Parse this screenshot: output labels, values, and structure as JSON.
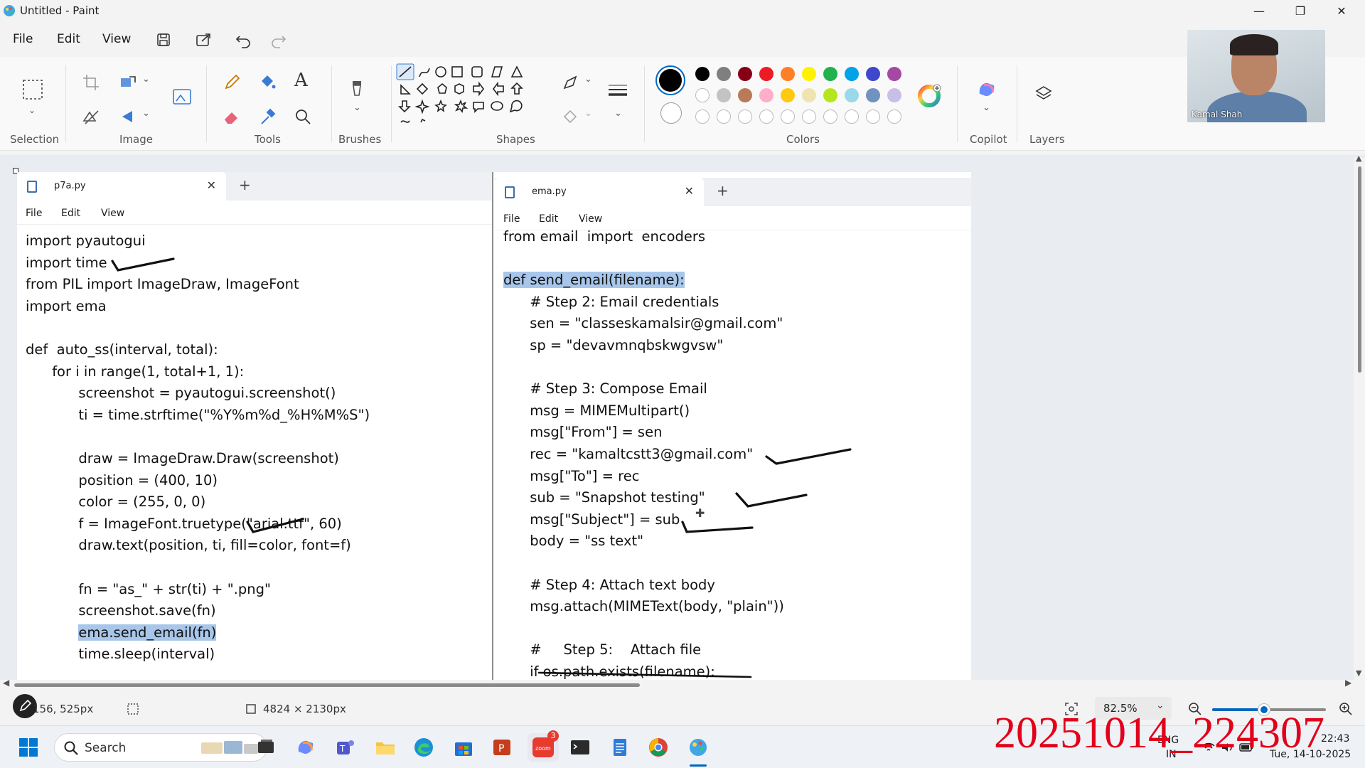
{
  "window": {
    "title": "Untitled - Paint"
  },
  "menu": {
    "file": "File",
    "edit": "Edit",
    "view": "View"
  },
  "ribbon": {
    "groups": {
      "selection": "Selection",
      "image": "Image",
      "tools": "Tools",
      "brushes": "Brushes",
      "shapes": "Shapes",
      "colors": "Colors",
      "copilot": "Copilot",
      "layers": "Layers"
    },
    "palette_row1": [
      "#000000",
      "#7f7f7f",
      "#880015",
      "#ed1c24",
      "#ff7f27",
      "#fff200",
      "#22b14c",
      "#00a2e8",
      "#3f48cc",
      "#a349a4"
    ],
    "palette_row2": [
      "#ffffff",
      "#c3c3c3",
      "#b97a57",
      "#ffaec9",
      "#ffc90e",
      "#efe4b0",
      "#b5e61d",
      "#99d9ea",
      "#7092be",
      "#c8bfe7"
    ],
    "primary_color": "#000000",
    "secondary_color": "#ffffff"
  },
  "webcam": {
    "name": "Kamal Shah"
  },
  "left_pane": {
    "tab": "p7a.py",
    "menu": {
      "file": "File",
      "edit": "Edit",
      "view": "View"
    },
    "lines": [
      "import pyautogui",
      "import time",
      "from PIL import ImageDraw, ImageFont",
      "import ema",
      "",
      "def  auto_ss(interval, total):",
      "      for i in range(1, total+1, 1):",
      "            screenshot = pyautogui.screenshot()",
      "            ti = time.strftime(\"%Y%m%d_%H%M%S\")",
      "",
      "            draw = ImageDraw.Draw(screenshot)",
      "            position = (400, 10)",
      "            color = (255, 0, 0)",
      "            f = ImageFont.truetype(\"arial.ttf\", 60)",
      "            draw.text(position, ti, fill=color, font=f)",
      "",
      "            fn = \"as_\" + str(ti) + \".png\"",
      "            screenshot.save(fn)",
      "            ema.send_email(fn)",
      "            time.sleep(interval)"
    ],
    "highlight_line": 18
  },
  "right_pane": {
    "tab": "ema.py",
    "menu": {
      "file": "File",
      "edit": "Edit",
      "view": "View"
    },
    "lines": [
      "from email  import  encoders",
      "",
      "def send_email(filename):",
      "      # Step 2: Email credentials",
      "      sen = \"classeskamalsir@gmail.com\"",
      "      sp = \"devavmnqbskwgvsw\"",
      "",
      "      # Step 3: Compose Email",
      "      msg = MIMEMultipart()",
      "      msg[\"From\"] = sen",
      "      rec = \"kamaltcstt3@gmail.com\"",
      "      msg[\"To\"] = rec",
      "      sub = \"Snapshot testing\"",
      "      msg[\"Subject\"] = sub",
      "      body = \"ss text\"",
      "",
      "      # Step 4: Attach text body",
      "      msg.attach(MIMEText(body, \"plain\"))",
      "",
      "      #     Step 5:    Attach file",
      "      if os.path.exists(filename):"
    ],
    "highlight_line": 2
  },
  "status": {
    "cursor_pos": "156, 525px",
    "canvas_size": "4824 × 2130px",
    "zoom": "82.5%",
    "zoom_level_percent": 82.5
  },
  "taskbar": {
    "search_label": "Search",
    "zoom_badge": "3",
    "lang_top": "ENG",
    "lang_bottom": "IN",
    "time": "22:43",
    "date": "Tue, 14-10-2025"
  },
  "overlay": {
    "timestamp": "20251014_224307"
  }
}
